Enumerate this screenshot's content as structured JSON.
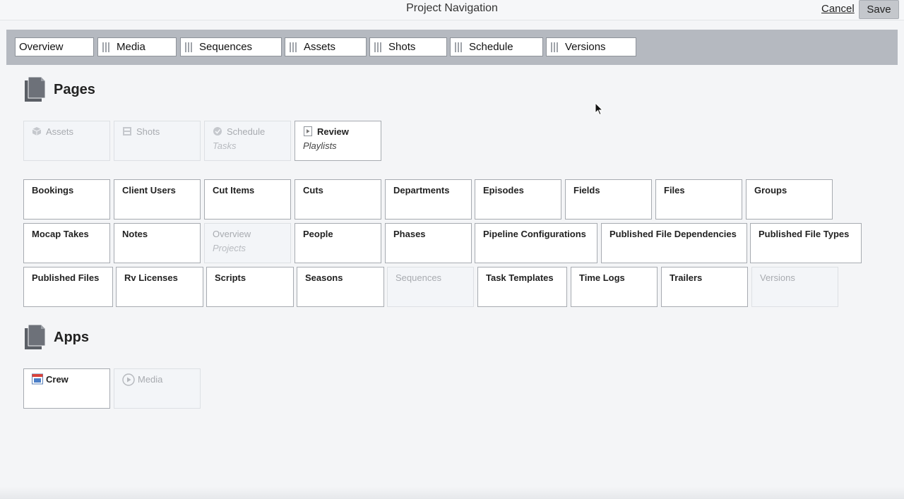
{
  "header": {
    "title": "Project Navigation",
    "cancel_label": "Cancel",
    "save_label": "Save"
  },
  "nav_tabs": [
    {
      "label": "Overview"
    },
    {
      "label": "Media"
    },
    {
      "label": "Sequences"
    },
    {
      "label": "Assets"
    },
    {
      "label": "Shots"
    },
    {
      "label": "Schedule"
    },
    {
      "label": "Versions"
    }
  ],
  "pages_section": {
    "title": "Pages",
    "featured": [
      {
        "name": "Assets",
        "icon": "cube-icon",
        "enabled": false
      },
      {
        "name": "Shots",
        "icon": "film-icon",
        "enabled": false
      },
      {
        "name": "Schedule",
        "sub": "Tasks",
        "icon": "check-circle-icon",
        "enabled": false
      },
      {
        "name": "Review",
        "sub": "Playlists",
        "icon": "play-document-icon",
        "enabled": true
      }
    ],
    "rows": [
      [
        {
          "name": "Bookings",
          "enabled": true
        },
        {
          "name": "Client Users",
          "enabled": true
        },
        {
          "name": "Cut Items",
          "enabled": true
        },
        {
          "name": "Cuts",
          "enabled": true
        },
        {
          "name": "Departments",
          "enabled": true
        },
        {
          "name": "Episodes",
          "enabled": true
        },
        {
          "name": "Fields",
          "enabled": true
        },
        {
          "name": "Files",
          "enabled": true
        },
        {
          "name": "Groups",
          "enabled": true
        }
      ],
      [
        {
          "name": "Mocap Takes",
          "enabled": true
        },
        {
          "name": "Notes",
          "enabled": true
        },
        {
          "name": "Overview",
          "sub": "Projects",
          "enabled": false
        },
        {
          "name": "People",
          "enabled": true
        },
        {
          "name": "Phases",
          "enabled": true
        },
        {
          "name": "Pipeline Configurations",
          "enabled": true
        },
        {
          "name": "Published File Dependencies",
          "enabled": true
        },
        {
          "name": "Published File Types",
          "enabled": true
        }
      ],
      [
        {
          "name": "Published Files",
          "enabled": true
        },
        {
          "name": "Rv Licenses",
          "enabled": true
        },
        {
          "name": "Scripts",
          "enabled": true
        },
        {
          "name": "Seasons",
          "enabled": true
        },
        {
          "name": "Sequences",
          "enabled": false
        },
        {
          "name": "Task Templates",
          "enabled": true
        },
        {
          "name": "Time Logs",
          "enabled": true
        },
        {
          "name": "Trailers",
          "enabled": true
        },
        {
          "name": "Versions",
          "enabled": false
        }
      ]
    ]
  },
  "apps_section": {
    "title": "Apps",
    "apps": [
      {
        "name": "Crew",
        "icon": "calendar-icon",
        "enabled": true
      },
      {
        "name": "Media",
        "icon": "play-circle-icon",
        "enabled": false
      }
    ]
  },
  "colors": {
    "nav_bar": "#b5b9c0",
    "card_border": "#a7abb1",
    "disabled_text": "#a8abb0",
    "background": "#f4f5f7"
  }
}
